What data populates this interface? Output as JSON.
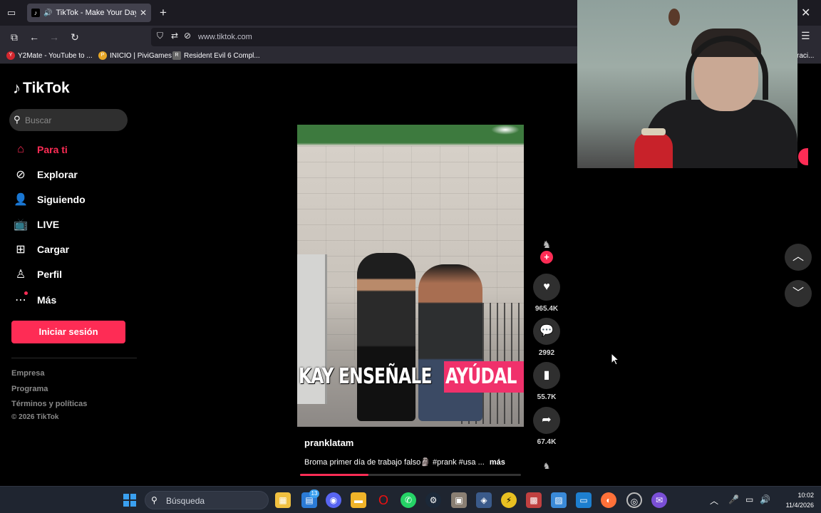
{
  "browser": {
    "tab_title": "TikTok - Make Your Day",
    "url": "www.tiktok.com",
    "bookmarks": [
      {
        "label": "Y2Mate - YouTube to ...",
        "icon": "y2mate-icon"
      },
      {
        "label": "INICIO | PiviGames",
        "icon": "pivigames-icon"
      },
      {
        "label": "Resident Evil 6 Compl...",
        "icon": "resident-evil-icon"
      }
    ],
    "bookmarks_overflow": "raci..."
  },
  "tiktok": {
    "logo_text": "TikTok",
    "search_placeholder": "Buscar",
    "nav": [
      {
        "label": "Para ti",
        "icon": "home-icon",
        "active": true
      },
      {
        "label": "Explorar",
        "icon": "compass-icon",
        "active": false
      },
      {
        "label": "Siguiendo",
        "icon": "following-icon",
        "active": false
      },
      {
        "label": "LIVE",
        "icon": "live-icon",
        "active": false
      },
      {
        "label": "Cargar",
        "icon": "upload-icon",
        "active": false
      },
      {
        "label": "Perfil",
        "icon": "profile-icon",
        "active": false
      },
      {
        "label": "Más",
        "icon": "more-icon",
        "active": false
      }
    ],
    "login_label": "Iniciar sesión",
    "footer_links": [
      "Empresa",
      "Programa",
      "Términos y políticas"
    ],
    "copyright": "© 2026 TikTok",
    "video": {
      "caption_white": "KAY ENSEÑALE",
      "caption_pink": "AYÚDAL",
      "author": "pranklatam",
      "description": "Broma primer día de trabajo falso🗿 #prank #usa ...",
      "more_label": "más",
      "progress": 0.31,
      "likes": "965.4K",
      "comments": "2992",
      "saves": "55.7K",
      "shares": "67.4K"
    }
  },
  "taskbar": {
    "search_label": "Búsqueda",
    "badge_count": "13",
    "time": "10:02",
    "date": "11/4/2026"
  },
  "colors": {
    "accent": "#fe2c55",
    "taskbar_bg": "#1f2530"
  }
}
